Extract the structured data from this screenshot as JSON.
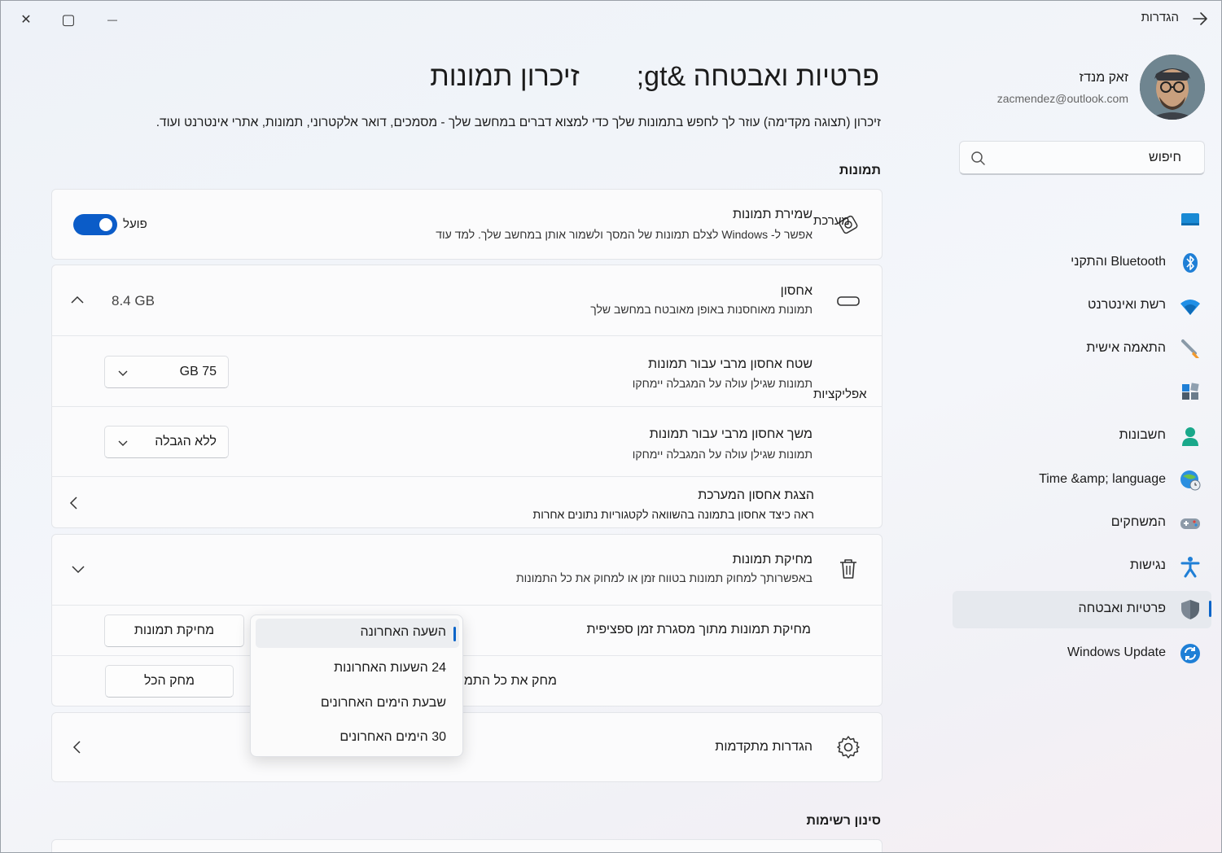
{
  "window": {
    "title": "הגדרות",
    "close_glyph": "✕",
    "maximize_glyph": "▢",
    "minimize_glyph": "—"
  },
  "user": {
    "name": "זאק מנדז",
    "email": "zacmendez@outlook.com"
  },
  "search": {
    "placeholder": "חיפוש"
  },
  "nav": {
    "items": [
      {
        "label": "",
        "icon": "system-icon"
      },
      {
        "label": "Bluetooth והתקני",
        "icon": "bluetooth-icon"
      },
      {
        "label": "רשת ואינטרנט",
        "icon": "wifi-icon"
      },
      {
        "label": "התאמה אישית",
        "icon": "brush-icon"
      },
      {
        "label": "",
        "icon": "apps-icon"
      },
      {
        "label": "חשבונות",
        "icon": "account-icon"
      },
      {
        "label": "Time &amp; language",
        "icon": "globe-clock-icon"
      },
      {
        "label": "המשחקים",
        "icon": "gamepad-icon"
      },
      {
        "label": "נגישות",
        "icon": "accessibility-icon"
      },
      {
        "label": "פרטיות ואבטחה",
        "icon": "shield-icon",
        "active": true
      },
      {
        "label": "Windows Update",
        "icon": "update-icon"
      }
    ]
  },
  "page": {
    "title_left": "פרטיות ואבטחה &gt;",
    "title_right": "זיכרון תמונות",
    "description": "זיכרון (תצוגה מקדימה) עוזר לך לחפש בתמונות שלך כדי למצוא דברים במחשב שלך - מסמכים, דואר אלקטרוני, תמונות, אתרי אינטרנט ועוד."
  },
  "sections": {
    "snapshots_heading": "תמונות",
    "filter_heading": "סינון רשימות"
  },
  "save_snapshots": {
    "title": "שמירת תמונות",
    "subtitle": "אפשר ל- Windows לצלם תמונות של המסך ולשמור אותן במחשב שלך. למד עוד",
    "overlay_text": "מערכת",
    "toggle_label": "פועל",
    "toggle_on": true
  },
  "storage": {
    "title": "אחסון",
    "subtitle": "תמונות מאוחסנות באופן מאובטח במחשב שלך",
    "value": "8.4 GB"
  },
  "max_storage": {
    "title": "שטח אחסון מרבי עבור תמונות",
    "subtitle": "תמונות שגילן עולה על המגבלה יימחקו",
    "overlay_text": "אפליקציות",
    "selected": "75 GB"
  },
  "max_duration": {
    "title": "משך אחסון מרבי עבור תמונות",
    "subtitle": "תמונות שגילן עולה על המגבלה יימחקו",
    "selected": "ללא הגבלה"
  },
  "system_storage": {
    "title": "הצגת אחסון המערכת",
    "subtitle": "ראה כיצד אחסון בתמונה בהשוואה לקטגוריות נתונים אחרות"
  },
  "delete_snapshots": {
    "title": "מחיקת תמונות",
    "subtitle": "באפשרותך למחוק תמונות בטווח זמן או למחוק את כל התמונות",
    "timeframe_label": "מחיקת תמונות מתוך מסגרת זמן ספציפית",
    "timeframe_button": "מחיקת תמונות",
    "delete_all_label": "מחק את כל התמונות",
    "delete_all_button": "מחק הכל"
  },
  "timeframe_popup": {
    "options": [
      "השעה האחרונה",
      "24 השעות האחרונות",
      "שבעת הימים האחרונים",
      "30 הימים האחרונים"
    ],
    "selected_index": 0
  },
  "advanced": {
    "title": "הגדרות מתקדמות"
  },
  "colors": {
    "accent": "#0b5cc8"
  }
}
